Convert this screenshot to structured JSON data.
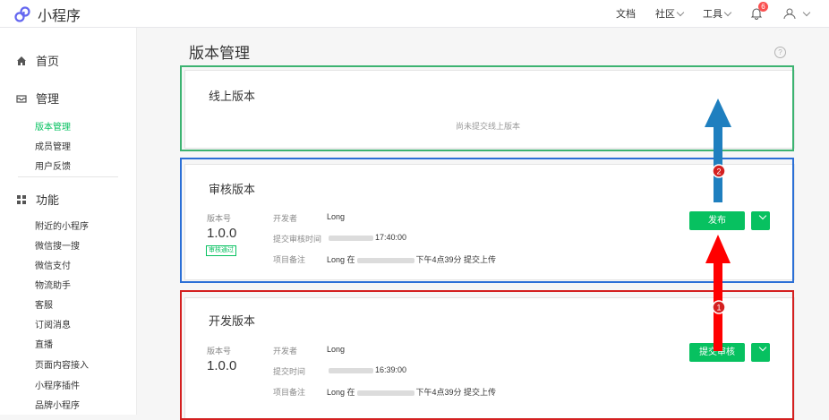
{
  "app": {
    "title": "小程序"
  },
  "topnav": {
    "docs": "文档",
    "community": "社区",
    "tools": "工具",
    "notifications": "6"
  },
  "sidebar": {
    "home": "首页",
    "manage": {
      "label": "管理",
      "items": [
        "版本管理",
        "成员管理",
        "用户反馈"
      ]
    },
    "features": {
      "label": "功能",
      "items": [
        "附近的小程序",
        "微信搜一搜",
        "微信支付",
        "物流助手",
        "客服",
        "订阅消息",
        "直播",
        "页面内容接入",
        "小程序插件",
        "品牌小程序"
      ]
    }
  },
  "page": {
    "title": "版本管理"
  },
  "online": {
    "title": "线上版本",
    "empty": "尚未提交线上版本"
  },
  "review": {
    "title": "审核版本",
    "version_label": "版本号",
    "version": "1.0.0",
    "status": "审核通过",
    "developer_label": "开发者",
    "developer": "Long",
    "time_label": "提交审核时间",
    "time": "17:40:00",
    "note_label": "项目备注",
    "note_prefix": "Long 在",
    "note_suffix": "下午4点39分 提交上传",
    "button": "发布"
  },
  "dev": {
    "title": "开发版本",
    "version_label": "版本号",
    "version": "1.0.0",
    "developer_label": "开发者",
    "developer": "Long",
    "time_label": "提交时间",
    "time": "16:39:00",
    "note_label": "项目备注",
    "note_prefix": "Long 在",
    "note_suffix": "下午4点39分 提交上传",
    "button": "提交审核"
  },
  "annotations": {
    "step1": "1",
    "step2": "2"
  },
  "colors": {
    "accent": "#07c160",
    "frame_green": "#3cb371",
    "frame_blue": "#2b6fd6",
    "frame_red": "#d42020",
    "arrow_red": "#ff0000",
    "arrow_blue": "#1f7fbf"
  }
}
